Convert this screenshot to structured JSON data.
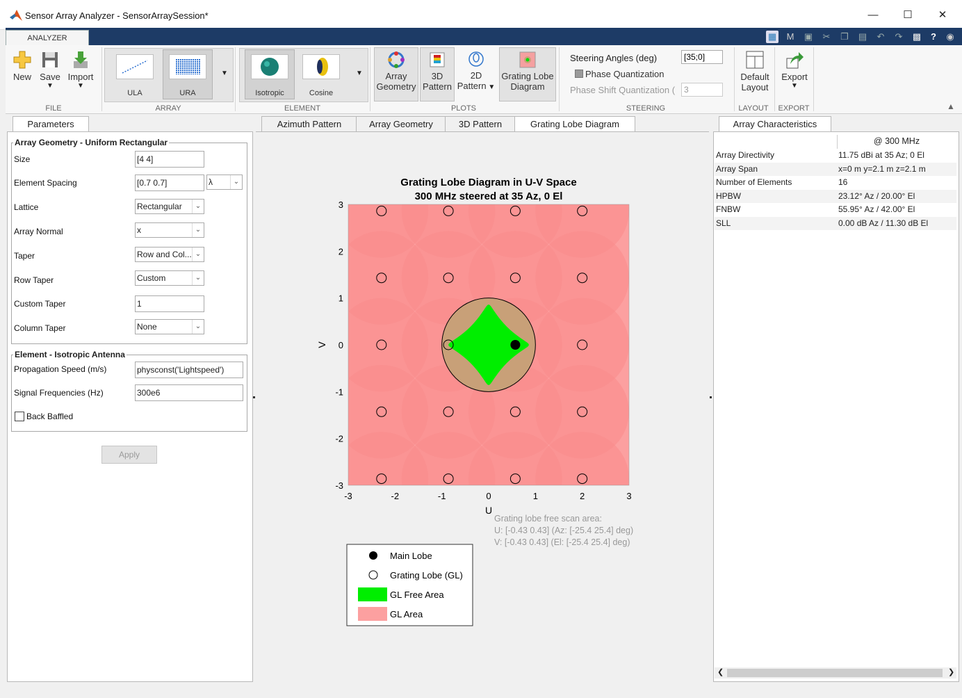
{
  "window": {
    "title": "Sensor Array Analyzer - SensorArraySession*"
  },
  "ribbon": {
    "tab": "ANALYZER",
    "file": {
      "label": "FILE",
      "new": "New",
      "save": "Save",
      "import": "Import"
    },
    "array": {
      "label": "ARRAY",
      "ula": "ULA",
      "ura": "URA"
    },
    "element": {
      "label": "ELEMENT",
      "isotropic": "Isotropic",
      "cosine": "Cosine"
    },
    "plots": {
      "label": "PLOTS",
      "array_geometry": [
        "Array",
        "Geometry"
      ],
      "pattern3d": [
        "3D",
        "Pattern"
      ],
      "pattern2d": [
        "2D",
        "Pattern"
      ],
      "grating_lobe": [
        "Grating Lobe",
        "Diagram"
      ]
    },
    "steering": {
      "label": "STEERING",
      "angles_label": "Steering Angles (deg)",
      "angles_value": "[35;0]",
      "phase_quant_label": "Phase Quantization",
      "phase_shift_label": "Phase Shift Quantization (",
      "phase_shift_value": "3"
    },
    "layout": {
      "label": "LAYOUT",
      "default": [
        "Default",
        "Layout"
      ]
    },
    "export": {
      "label": "EXPORT",
      "export": "Export"
    }
  },
  "params": {
    "tab": "Parameters",
    "geometry_legend": "Array Geometry - Uniform Rectangular",
    "size": {
      "label": "Size",
      "value": "[4 4]"
    },
    "spacing": {
      "label": "Element Spacing",
      "value": "[0.7 0.7]",
      "unit": "λ"
    },
    "lattice": {
      "label": "Lattice",
      "value": "Rectangular"
    },
    "normal": {
      "label": "Array Normal",
      "value": "x"
    },
    "taper": {
      "label": "Taper",
      "value": "Row and Col..."
    },
    "row_taper": {
      "label": "Row Taper",
      "value": "Custom"
    },
    "custom_taper": {
      "label": "Custom Taper",
      "value": "1"
    },
    "column_taper": {
      "label": "Column Taper",
      "value": "None"
    },
    "element_legend": "Element - Isotropic Antenna",
    "prop_speed": {
      "label": "Propagation Speed (m/s)",
      "value": "physconst('Lightspeed')"
    },
    "sig_freq": {
      "label": "Signal Frequencies (Hz)",
      "value": "300e6"
    },
    "back_baffled": "Back Baffled",
    "apply": "Apply"
  },
  "center": {
    "tabs": [
      "Azimuth Pattern",
      "Array Geometry",
      "3D Pattern",
      "Grating Lobe Diagram"
    ],
    "active_tab": 3
  },
  "chart_data": {
    "type": "scatter",
    "title": "Grating Lobe Diagram in U-V Space",
    "subtitle": "300 MHz steered at 35 Az, 0 El",
    "xlabel": "U",
    "ylabel": "V",
    "xlim": [
      -3,
      3
    ],
    "ylim": [
      -3,
      3
    ],
    "xticks": [
      "-3",
      "-2",
      "-1",
      "0",
      "1",
      "2",
      "3"
    ],
    "yticks": [
      "3",
      "2",
      "1",
      "0",
      "-1",
      "-2",
      "-3"
    ],
    "main_lobe": {
      "u": 0.57,
      "v": 0
    },
    "grating_lobes_u": [
      -2.29,
      -0.86,
      0.57,
      2.0
    ],
    "grating_lobes_v": [
      2.86,
      1.43,
      0,
      -1.43,
      -2.86
    ],
    "annotation": [
      "Grating lobe free scan area:",
      "U: [-0.43 0.43] (Az: [-25.4 25.4] deg)",
      "V: [-0.43 0.43] (El: [-25.4 25.4] deg)"
    ],
    "legend": [
      "Main Lobe",
      "Grating Lobe (GL)",
      "GL Free Area",
      "GL Area"
    ],
    "colors": {
      "gl_area": "#fca0a0",
      "gl_overlap": "#f98b8b",
      "gl_free": "#00ee00",
      "visible": "#c8a078"
    }
  },
  "characteristics": {
    "tab": "Array Characteristics",
    "header": "@ 300 MHz",
    "rows": [
      {
        "name": "Array Directivity",
        "value": "11.75 dBi at 35 Az; 0 El"
      },
      {
        "name": "Array Span",
        "value": "x=0 m y=2.1 m z=2.1 m"
      },
      {
        "name": "Number of Elements",
        "value": "16"
      },
      {
        "name": "HPBW",
        "value": "23.12° Az / 20.00° El"
      },
      {
        "name": "FNBW",
        "value": "55.95° Az / 42.00° El"
      },
      {
        "name": "SLL",
        "value": "0.00 dB Az / 11.30 dB El"
      }
    ]
  }
}
